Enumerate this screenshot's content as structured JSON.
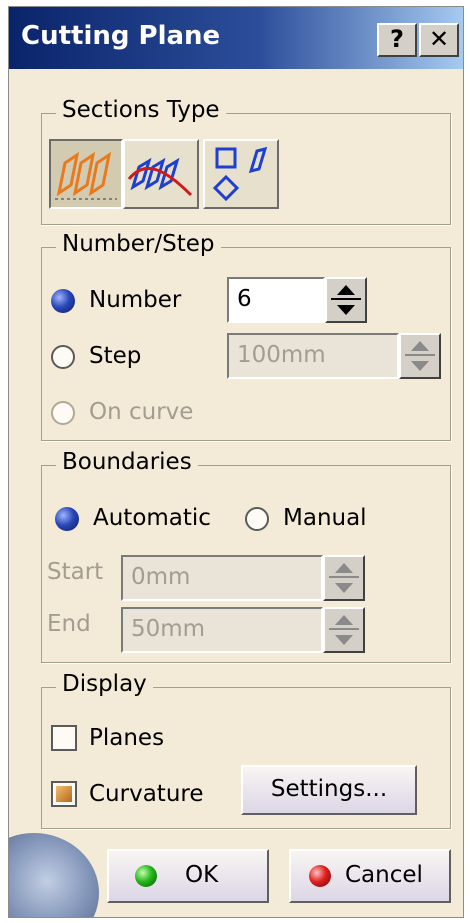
{
  "window": {
    "title": "Cutting Plane",
    "help_button": "?",
    "close_button": "✕"
  },
  "sections_type": {
    "title": "Sections Type",
    "buttons": [
      {
        "icon": "parallel-planes-icon",
        "pressed": true
      },
      {
        "icon": "curve-sections-icon",
        "pressed": false
      },
      {
        "icon": "shapes-icon",
        "pressed": false
      }
    ]
  },
  "number_step": {
    "title": "Number/Step",
    "number_label": "Number",
    "number_value": "6",
    "step_label": "Step",
    "step_value": "100mm",
    "on_curve_label": "On curve",
    "selected": "Number"
  },
  "boundaries": {
    "title": "Boundaries",
    "automatic_label": "Automatic",
    "manual_label": "Manual",
    "selected": "Automatic",
    "start_label": "Start",
    "start_value": "0mm",
    "end_label": "End",
    "end_value": "50mm"
  },
  "display": {
    "title": "Display",
    "planes_label": "Planes",
    "curvature_label": "Curvature",
    "settings_button": "Settings..."
  },
  "footer": {
    "ok_button": "OK",
    "cancel_button": "Cancel"
  },
  "colors": {
    "title_bar": "#0a246a",
    "dialog_bg": "#f3ebd7",
    "radio_selected": "#2a49b8",
    "icon_orange": "#e87a1e",
    "icon_blue": "#1f3fd0",
    "icon_red": "#d01a1a"
  }
}
